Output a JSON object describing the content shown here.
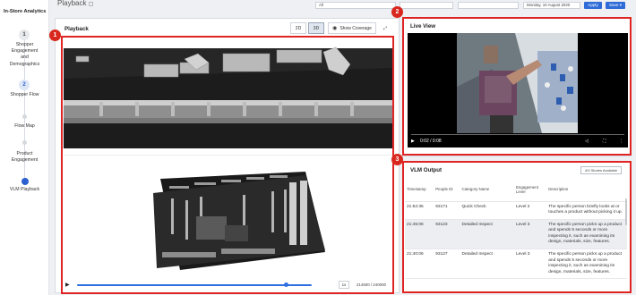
{
  "app": {
    "brand": "In-Store Analytics",
    "page_title": "Playback"
  },
  "sidebar": {
    "steps": [
      {
        "number": "1",
        "label_lines": [
          "Shopper",
          "Engagement",
          "and",
          "Demographics"
        ],
        "state": "inactive"
      },
      {
        "number": "2",
        "label_lines": [
          "Shopper Flow"
        ],
        "state": "current"
      },
      {
        "number": "",
        "label_lines": [
          "Flow Map"
        ],
        "state": "dot"
      },
      {
        "number": "",
        "label_lines": [
          "Product",
          "Engagement"
        ],
        "state": "dot"
      },
      {
        "number": "",
        "label_lines": [
          "VLM Playback"
        ],
        "state": "active"
      }
    ]
  },
  "topbar": {
    "filter1": "All",
    "filter4": "Monday, 10 August 2020",
    "apply_label": "Apply",
    "save_label": "Save"
  },
  "annotations": {
    "badge1": "1",
    "badge2": "2",
    "badge3": "3"
  },
  "playback": {
    "title": "Playback",
    "btn_2d": "2D",
    "btn_3d": "3D",
    "coverage_label": "Show Coverage",
    "speed": "1x",
    "time": "214500 / 240000",
    "progress": 0.89
  },
  "live_view": {
    "title": "Live View",
    "time": "0:02 / 0:08"
  },
  "vlm": {
    "title": "VLM Output",
    "stories_label": "4/3 Stories Available",
    "columns": [
      "Timestamp",
      "People ID",
      "Category Name",
      "Engagement Level",
      "Description"
    ],
    "rows": [
      {
        "timestamp": "21:52:35",
        "people_id": "93171",
        "category": "Quick Check",
        "level": "Level 2",
        "description": "The specific person briefly looks at or touches a product without picking it up.",
        "highlight": false
      },
      {
        "timestamp": "21:45:06",
        "people_id": "93123",
        "category": "Detailed Inspect",
        "level": "Level 3",
        "description": "The specific person picks up a product and spends 5 seconds or more inspecting it, such as examining its design, materials, size, features.",
        "highlight": true
      },
      {
        "timestamp": "21:40:06",
        "people_id": "93127",
        "category": "Detailed Inspect",
        "level": "Level 3",
        "description": "The specific person picks up a product and spends 5 seconds or more inspecting it, such as examining its design, materials, size, features.",
        "highlight": false
      }
    ]
  },
  "colors": {
    "accent": "#2f6cd7",
    "annotation": "#e02424",
    "active_step": "#2b5fd0"
  }
}
